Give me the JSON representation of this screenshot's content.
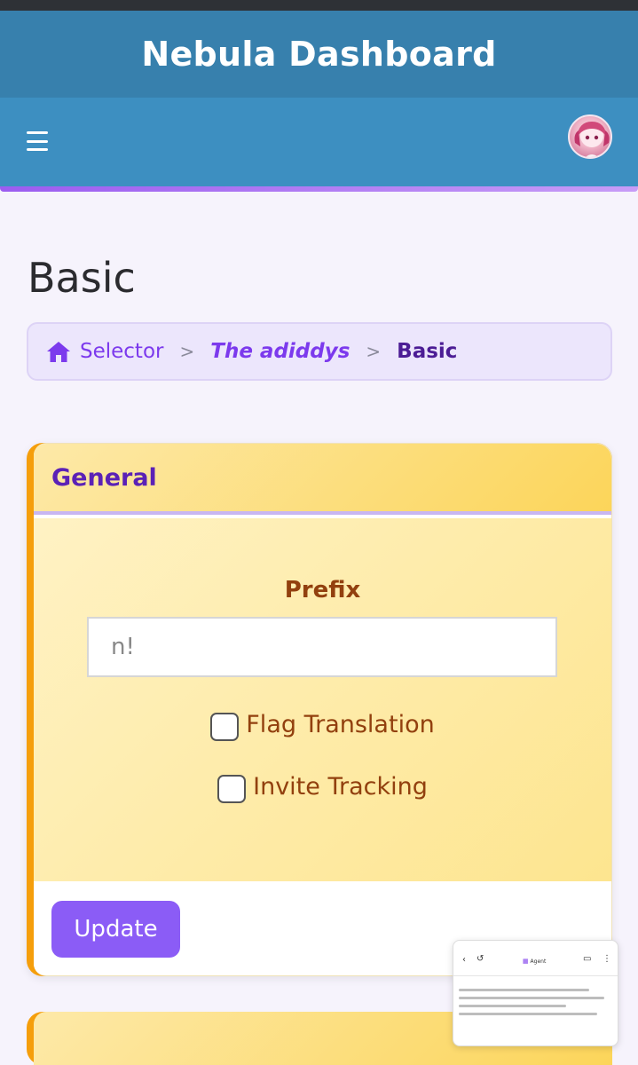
{
  "header": {
    "title": "Nebula Dashboard"
  },
  "nav": {
    "menu_icon": "hamburger-icon",
    "avatar": "user-avatar"
  },
  "page": {
    "title": "Basic"
  },
  "breadcrumb": {
    "home_icon": "home-icon",
    "items": [
      "Selector",
      "The adiddys",
      "Basic"
    ],
    "separator": ">"
  },
  "general_card": {
    "title": "General",
    "prefix_label": "Prefix",
    "prefix_placeholder": "n!",
    "checkboxes": [
      {
        "label": "Flag Translation",
        "checked": false
      },
      {
        "label": "Invite Tracking",
        "checked": false
      }
    ],
    "update_label": "Update"
  },
  "overlay": {
    "title": "Agent"
  },
  "colors": {
    "titlebar": "#3780ad",
    "navbar": "#3d8fc1",
    "accent": "#8b5cf6",
    "card_edge": "#f59e0b",
    "label_brown": "#92400e"
  }
}
